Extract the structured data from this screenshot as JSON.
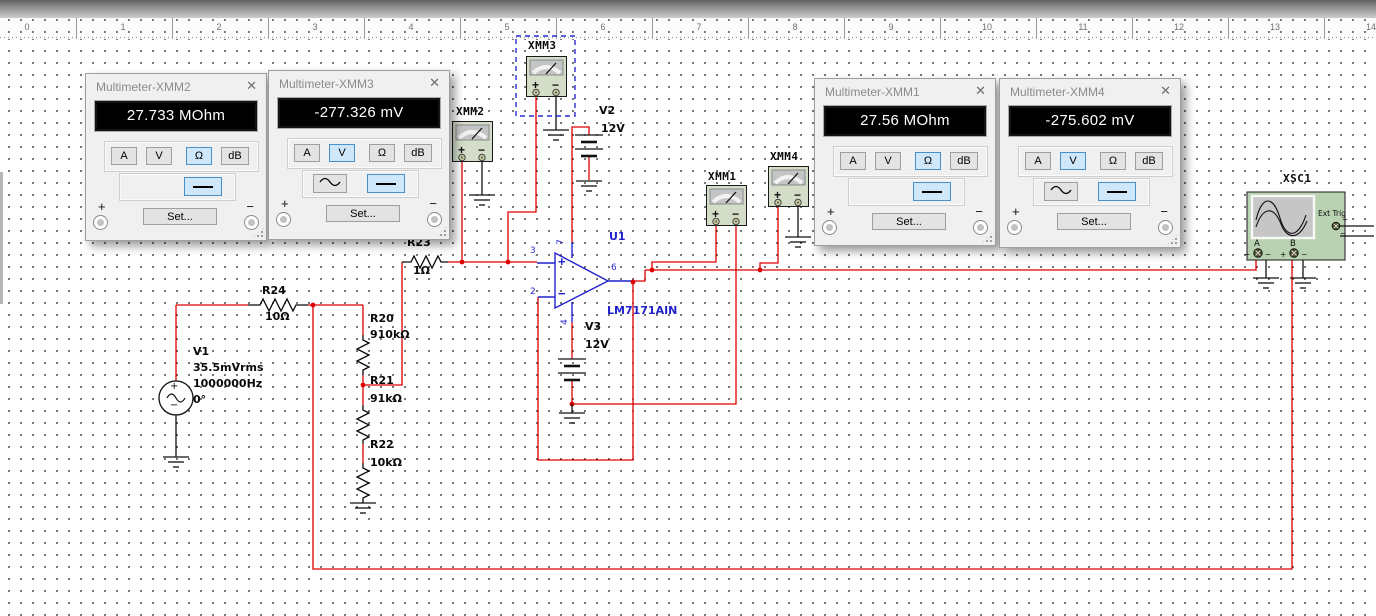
{
  "ruler": {
    "numbers": [
      "0",
      "1",
      "2",
      "3",
      "4",
      "5",
      "6",
      "7",
      "8",
      "9",
      "10",
      "11",
      "12",
      "13",
      "14"
    ]
  },
  "meters": [
    {
      "name": "XMM2",
      "title": "Multimeter-XMM2",
      "value": "27.733 MOhm",
      "mode": "ohm",
      "signal": "dc"
    },
    {
      "name": "XMM3",
      "title": "Multimeter-XMM3",
      "value": "-277.326 mV",
      "mode": "volt",
      "signal": "dc"
    },
    {
      "name": "XMM1",
      "title": "Multimeter-XMM1",
      "value": "27.56 MOhm",
      "mode": "ohm",
      "signal": "dc"
    },
    {
      "name": "XMM4",
      "title": "Multimeter-XMM4",
      "value": "-275.602 mV",
      "mode": "volt",
      "signal": "dc"
    }
  ],
  "meter_ui": {
    "btn_a": "A",
    "btn_v": "V",
    "btn_ohm": "Ω",
    "btn_db": "dB",
    "set_label": "Set...",
    "close": "✕"
  },
  "signs": {
    "plus": "+",
    "minus": "−"
  },
  "components": {
    "r20": {
      "ref": "R20",
      "value": "910kΩ"
    },
    "r21": {
      "ref": "R21",
      "value": "91kΩ"
    },
    "r22": {
      "ref": "R22",
      "value": "10kΩ"
    },
    "r23": {
      "ref": "R23",
      "value": "1Ω"
    },
    "r24": {
      "ref": "R24",
      "value": "10Ω"
    },
    "v1": {
      "ref": "V1",
      "line1": "35.5mVrms",
      "line2": "1000000Hz",
      "line3": "0°"
    },
    "v2": {
      "ref": "V2",
      "value": "12V"
    },
    "v3": {
      "ref": "V3",
      "value": "12V"
    },
    "u1": {
      "ref": "U1",
      "part": "LM7171AIN",
      "pin_in_plus": "3",
      "pin_in_minus": "2",
      "pin_out": "6",
      "pin_vplus": "7",
      "pin_vminus": "4"
    },
    "xmm1": {
      "label": "XMM1"
    },
    "xmm2": {
      "label": "XMM2"
    },
    "xmm3": {
      "label": "XMM3"
    },
    "xmm4": {
      "label": "XMM4"
    },
    "xsc1": {
      "label": "XSC1",
      "ext_trig": "Ext Trig",
      "channel_a": "A",
      "channel_b": "B"
    }
  },
  "colors": {
    "wire_red": "#dd0000",
    "net_blue": "#2222cc",
    "selection_blue": "#2a2ad0",
    "selected_button_bg": "#cfe7fa",
    "selected_button_border": "#4a90c8",
    "display_bg": "#000000",
    "instrument_body": "#d3ddc8",
    "scope_body": "#b9d3b2"
  }
}
